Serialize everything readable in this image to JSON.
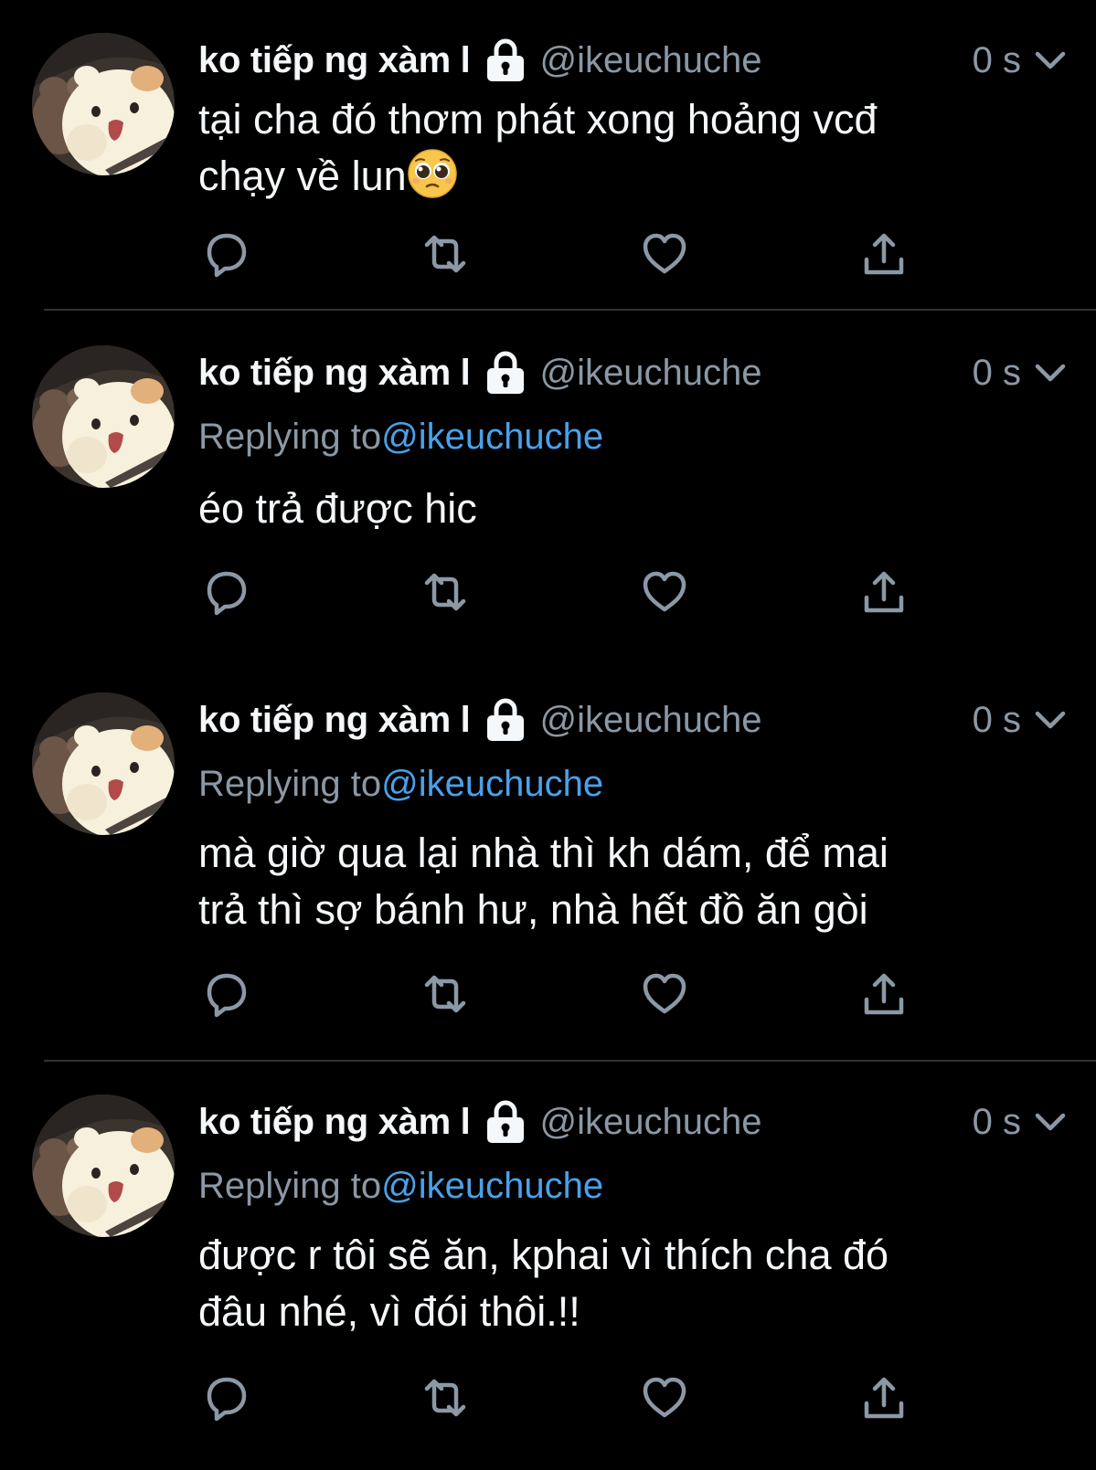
{
  "tweets": [
    {
      "display_name": "ko tiếp ng xàm l",
      "handle": "@ikeuchuche",
      "time": "0 s",
      "reply_prefix": "",
      "reply_to": "",
      "text": "tại cha đó thơm phát xong hoảng vcđ\nchạy về lun",
      "emoji": "pleading-face"
    },
    {
      "display_name": "ko tiếp ng xàm l",
      "handle": "@ikeuchuche",
      "time": "0 s",
      "reply_prefix": "Replying to",
      "reply_to": "@ikeuchuche",
      "text": "éo trả được hic"
    },
    {
      "display_name": "ko tiếp ng xàm l",
      "handle": "@ikeuchuche",
      "time": "0 s",
      "reply_prefix": "Replying to",
      "reply_to": "@ikeuchuche",
      "text": "mà giờ qua lại nhà thì kh dám, để mai\ntrả thì sợ bánh hư, nhà hết đồ ăn gòi"
    },
    {
      "display_name": "ko tiếp ng xàm l",
      "handle": "@ikeuchuche",
      "time": "0 s",
      "reply_prefix": "Replying to",
      "reply_to": "@ikeuchuche",
      "text": "được r tôi sẽ ăn, kphai vì thích cha đó\nđâu nhé, vì đói thôi.!!"
    }
  ],
  "icons": {
    "protected": "lock-icon",
    "menu": "chevron-down-icon",
    "reply": "reply-icon",
    "retweet": "retweet-icon",
    "like": "like-icon",
    "share": "share-icon"
  },
  "colors": {
    "background": "#000000",
    "text": "#f5f8fa",
    "secondary": "#8b98a5",
    "link": "#4aa1e9",
    "divider": "#2f3336"
  }
}
